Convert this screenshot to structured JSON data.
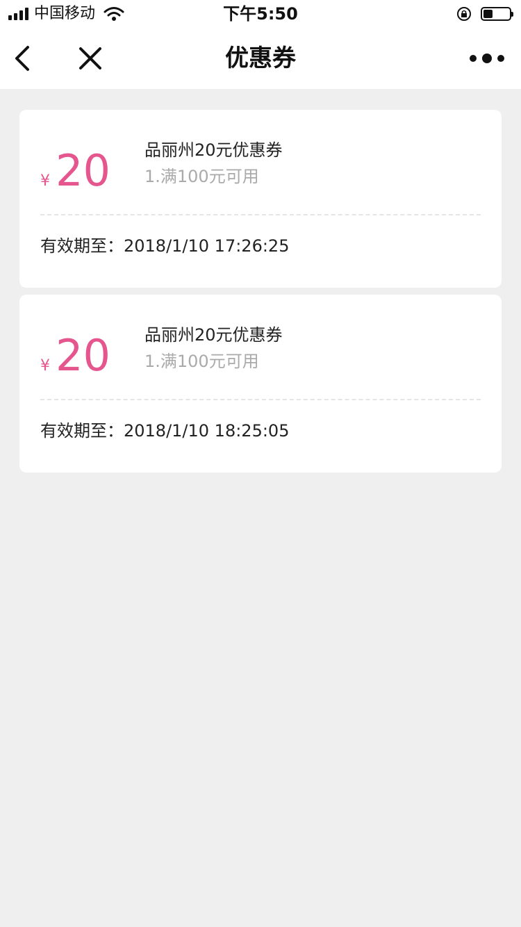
{
  "status_bar": {
    "carrier": "中国移动",
    "time": "下午5:50",
    "signal_bars": 4,
    "battery_level": 0.35
  },
  "nav": {
    "title": "优惠券",
    "back_icon": "chevron-left-icon",
    "close_icon": "close-icon",
    "more_icon": "more-dots-icon"
  },
  "colors": {
    "accent": "#e5558e",
    "background": "#efefef",
    "muted_text": "#aaaaaa"
  },
  "coupons": [
    {
      "currency": "¥",
      "amount": "20",
      "name": "品丽州20元优惠券",
      "condition": "1.满100元可用",
      "validity": "有效期至：2018/1/10 17:26:25"
    },
    {
      "currency": "¥",
      "amount": "20",
      "name": "品丽州20元优惠券",
      "condition": "1.满100元可用",
      "validity": "有效期至：2018/1/10 18:25:05"
    }
  ]
}
